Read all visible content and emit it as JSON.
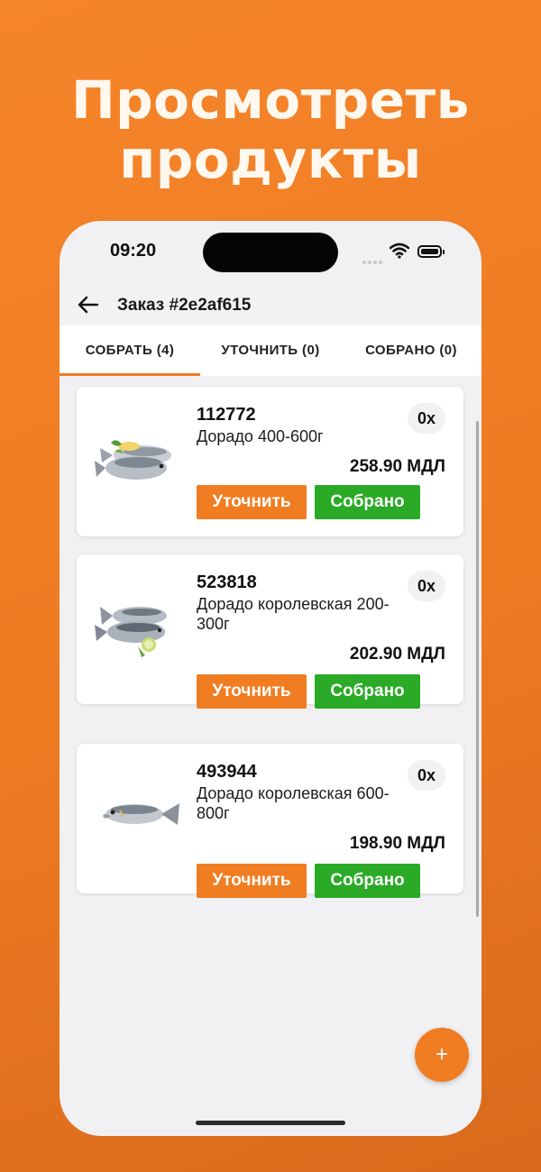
{
  "promo": {
    "line1": "Просмотреть",
    "line2": "продукты"
  },
  "status_bar": {
    "time": "09:20",
    "icons": [
      "cellular-signal-icon",
      "wifi-icon",
      "battery-icon"
    ]
  },
  "header": {
    "back_icon": "arrow-left-icon",
    "title": "Заказ #2e2af615"
  },
  "tabs": [
    {
      "label": "СОБРАТЬ (4)",
      "active": true
    },
    {
      "label": "УТОЧНИТЬ (0)",
      "active": false
    },
    {
      "label": "СОБРАНО (0)",
      "active": false
    }
  ],
  "products": [
    {
      "sku": "112772",
      "name": "Дорадо 400-600г",
      "qty": "0x",
      "price": "258.90 МДЛ",
      "clarify_label": "Уточнить",
      "collected_label": "Собрано"
    },
    {
      "sku": "523818",
      "name": "Дорадо королевская 200-300г",
      "qty": "0x",
      "price": "202.90 МДЛ",
      "clarify_label": "Уточнить",
      "collected_label": "Собрано"
    },
    {
      "sku": "493944",
      "name": "Дорадо королевская 600-800г",
      "qty": "0x",
      "price": "198.90 МДЛ",
      "clarify_label": "Уточнить",
      "collected_label": "Собрано"
    }
  ],
  "fab": {
    "label": "+",
    "icon": "plus-icon"
  },
  "colors": {
    "accent": "#f07d22",
    "success": "#2aaa26",
    "background": "#ee7a22"
  }
}
